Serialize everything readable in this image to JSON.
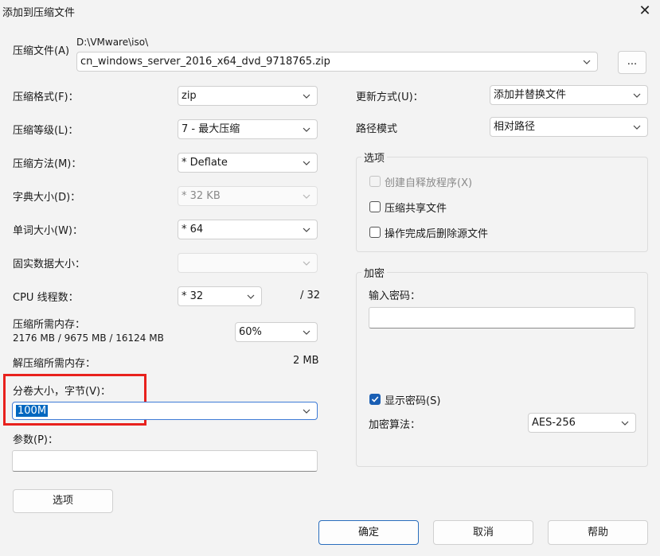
{
  "window": {
    "title": "添加到压缩文件",
    "close_glyph": "✕"
  },
  "archive": {
    "label": "压缩文件(A)",
    "path": "D:\\VMware\\iso\\",
    "filename": "cn_windows_server_2016_x64_dvd_9718765.zip",
    "browse_label": "..."
  },
  "left": {
    "format": {
      "label": "压缩格式(F)：",
      "value": "zip"
    },
    "level": {
      "label": "压缩等级(L)：",
      "value": "7 - 最大压缩"
    },
    "method": {
      "label": "压缩方法(M)：",
      "value": "* Deflate"
    },
    "dict": {
      "label": "字典大小(D)：",
      "value": "* 32 KB"
    },
    "word": {
      "label": "单词大小(W)：",
      "value": "* 64"
    },
    "solid": {
      "label": "固实数据大小：",
      "value": ""
    },
    "cpu": {
      "label": "CPU 线程数：",
      "value": "* 32",
      "max": "/ 32"
    },
    "mem_compress": {
      "label": "压缩所需内存：",
      "detail": "2176 MB / 9675 MB / 16124 MB",
      "value": "60%"
    },
    "mem_decompress": {
      "label": "解压缩所需内存：",
      "value": "2 MB"
    },
    "volume": {
      "label": "分卷大小，字节(V)：",
      "value": "100M"
    },
    "params": {
      "label": "参数(P)：",
      "value": ""
    },
    "options_button": "选项"
  },
  "right": {
    "update": {
      "label": "更新方式(U)：",
      "value": "添加并替换文件"
    },
    "pathmode": {
      "label": "路径模式",
      "value": "相对路径"
    },
    "options_group": {
      "title": "选项",
      "sfx": {
        "label": "创建自释放程序(X)",
        "checked": false,
        "disabled": true
      },
      "shared": {
        "label": "压缩共享文件",
        "checked": false
      },
      "delete": {
        "label": "操作完成后删除源文件",
        "checked": false
      }
    },
    "encrypt_group": {
      "title": "加密",
      "password_label": "输入密码：",
      "password_value": "",
      "show_password": {
        "label": "显示密码(S)",
        "checked": true
      },
      "method_label": "加密算法：",
      "method_value": "AES-256"
    }
  },
  "buttons": {
    "ok": "确定",
    "cancel": "取消",
    "help": "帮助"
  },
  "colors": {
    "highlight_box": "#e8211d",
    "accent": "#1a5fb4",
    "selection": "#0067c0"
  }
}
